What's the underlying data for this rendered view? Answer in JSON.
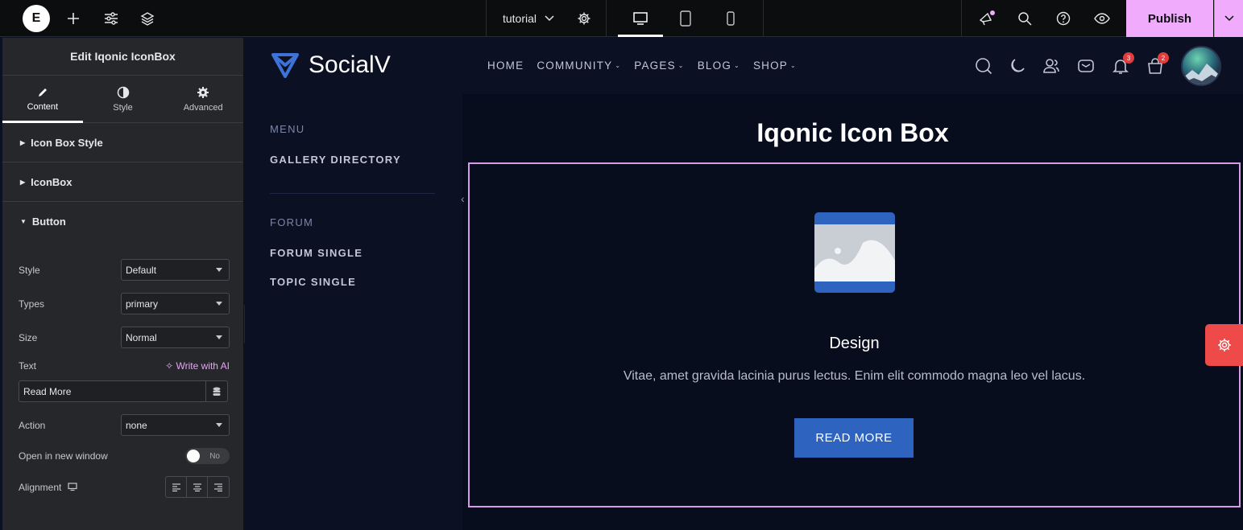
{
  "topbar": {
    "logo": "E",
    "document_title": "tutorial",
    "publish_label": "Publish",
    "icons": [
      "add-icon",
      "sliders-icon",
      "layers-icon",
      "chevron-down-icon",
      "gear-icon",
      "desktop-icon",
      "tablet-icon",
      "mobile-icon",
      "megaphone-icon",
      "search-icon",
      "help-icon",
      "eye-icon"
    ],
    "accent": "#f0abfc"
  },
  "panel": {
    "title": "Edit Iqonic IconBox",
    "tabs": [
      {
        "label": "Content",
        "icon": "pencil-icon",
        "active": true
      },
      {
        "label": "Style",
        "icon": "half-circle-icon",
        "active": false
      },
      {
        "label": "Advanced",
        "icon": "gear-icon",
        "active": false
      }
    ],
    "sections": [
      "Icon Box Style",
      "IconBox",
      "Button"
    ],
    "controls": {
      "style_label": "Style",
      "style_value": "Default",
      "types_label": "Types",
      "types_value": "primary",
      "size_label": "Size",
      "size_value": "Normal",
      "text_label": "Text",
      "write_ai": "Write with AI",
      "text_value": "Read More",
      "action_label": "Action",
      "action_value": "none",
      "new_window_label": "Open in new window",
      "new_window_value": "No",
      "alignment_label": "Alignment"
    }
  },
  "site": {
    "brand": "SocialV",
    "nav": [
      {
        "label": "HOME",
        "dropdown": false
      },
      {
        "label": "COMMUNITY",
        "dropdown": true
      },
      {
        "label": "PAGES",
        "dropdown": true
      },
      {
        "label": "BLOG",
        "dropdown": true
      },
      {
        "label": "SHOP",
        "dropdown": true
      }
    ],
    "badges": {
      "notifications": "3",
      "cart": "2"
    },
    "side_menu": {
      "menu_head": "MENU",
      "menu_items": [
        "GALLERY DIRECTORY"
      ],
      "forum_head": "FORUM",
      "forum_items": [
        "FORUM SINGLE",
        "TOPIC SINGLE"
      ]
    },
    "page_heading": "Iqonic Icon Box",
    "iconbox": {
      "title": "Design",
      "description": "Vitae, amet gravida lacinia purus lectus. Enim elit commodo magna leo vel lacus.",
      "button": "READ MORE"
    },
    "colors": {
      "primary": "#2f63c0",
      "background": "#080d1e",
      "float_button": "#ef4a4a"
    }
  }
}
